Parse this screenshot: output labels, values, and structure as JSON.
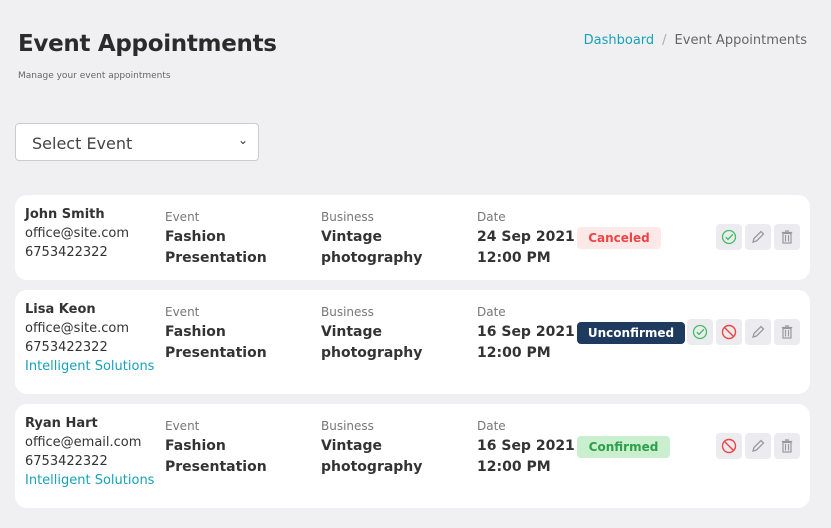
{
  "header": {
    "title": "Event Appointments",
    "subtitle": "Manage your event appointments"
  },
  "breadcrumb": {
    "home": "Dashboard",
    "separator": "/",
    "current": "Event Appointments"
  },
  "filter": {
    "selected": "Select Event"
  },
  "labels": {
    "event": "Event",
    "business": "Business",
    "date": "Date"
  },
  "colors": {
    "accent": "#17a2b8",
    "canceled_bg": "#fde8e8",
    "canceled_text": "#ef4444",
    "unconfirmed_bg": "#1e3a5f",
    "confirmed_bg": "#c9efcf",
    "confirmed_text": "#2e9e4a"
  },
  "appointments": [
    {
      "name": "John Smith",
      "email": "office@site.com",
      "phone": "6753422322",
      "company": "",
      "event1": "Fashion",
      "event2": "Presentation",
      "business1": "Vintage",
      "business2": "photography",
      "date1": "24 Sep 2021",
      "date2": "12:00 PM",
      "status": "Canceled",
      "actions": [
        "confirm",
        "edit",
        "delete"
      ]
    },
    {
      "name": "Lisa Keon",
      "email": "office@site.com",
      "phone": "6753422322",
      "company": "Intelligent Solutions",
      "event1": "Fashion",
      "event2": "Presentation",
      "business1": "Vintage",
      "business2": "photography",
      "date1": "16 Sep 2021",
      "date2": "12:00 PM",
      "status": "Unconfirmed",
      "actions": [
        "confirm",
        "cancel",
        "edit",
        "delete"
      ]
    },
    {
      "name": "Ryan Hart",
      "email": "office@email.com",
      "phone": "6753422322",
      "company": "Intelligent Solutions",
      "event1": "Fashion",
      "event2": "Presentation",
      "business1": "Vintage",
      "business2": "photography",
      "date1": "16 Sep 2021",
      "date2": "12:00 PM",
      "status": "Confirmed",
      "actions": [
        "cancel",
        "edit",
        "delete"
      ]
    }
  ]
}
